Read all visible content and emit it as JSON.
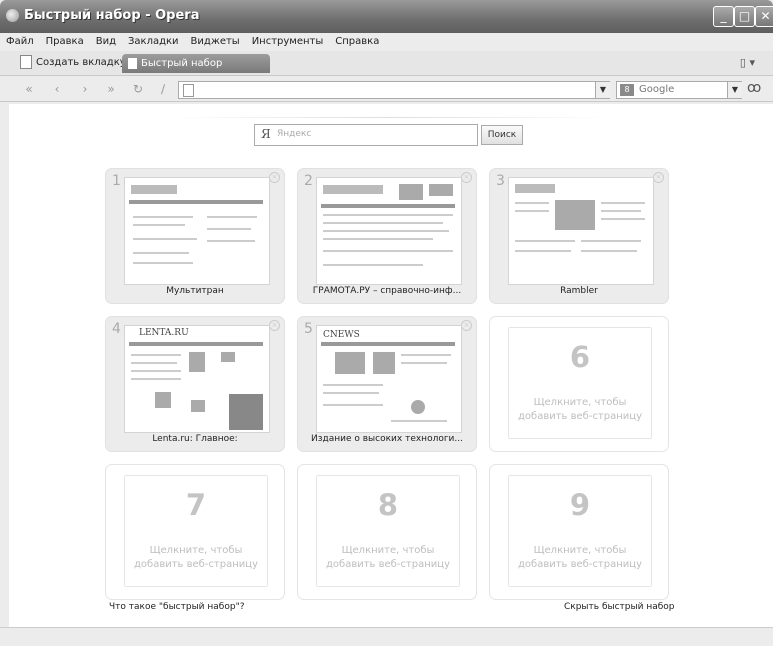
{
  "window": {
    "title": "Быстрый набор - Opera"
  },
  "menu": [
    "Файл",
    "Правка",
    "Вид",
    "Закладки",
    "Виджеты",
    "Инструменты",
    "Справка"
  ],
  "tabs": {
    "new_tab": "Создать вкладку",
    "active_tab": "Быстрый набор"
  },
  "search": {
    "engine": "Google"
  },
  "yandex": {
    "placeholder": "Яндекс",
    "button": "Поиск",
    "logo": "Я"
  },
  "speed_dial": {
    "tiles": [
      {
        "num": "1",
        "caption": "Мультитран"
      },
      {
        "num": "2",
        "caption": "ГРАМОТА.РУ – справочно-инф..."
      },
      {
        "num": "3",
        "caption": "Rambler"
      },
      {
        "num": "4",
        "caption": "Lenta.ru: Главное:"
      },
      {
        "num": "5",
        "caption": "Издание о высоких технологи..."
      },
      {
        "num": "6",
        "hint": "Щелкните, чтобы добавить веб-страницу"
      },
      {
        "num": "7",
        "hint": "Щелкните, чтобы добавить веб-страницу"
      },
      {
        "num": "8",
        "hint": "Щелкните, чтобы добавить веб-страницу"
      },
      {
        "num": "9",
        "hint": "Щелкните, чтобы добавить веб-страницу"
      }
    ],
    "thumb_logos": {
      "lenta": "LENTA.RU",
      "cnews": "CNEWS"
    }
  },
  "footer": {
    "what_is": "Что такое \"быстрый набор\"?",
    "hide": "Скрыть быстрый набор"
  }
}
